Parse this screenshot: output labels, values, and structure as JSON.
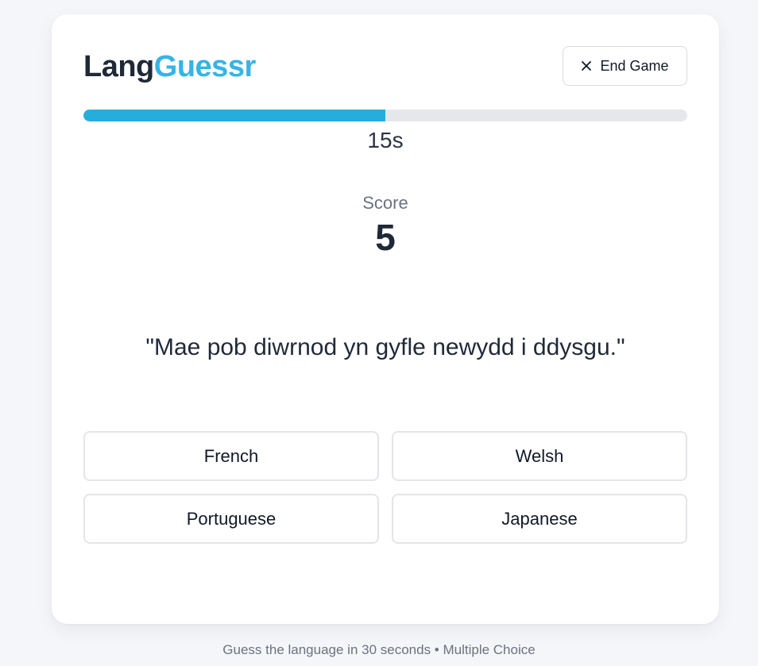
{
  "header": {
    "logo_part1": "Lang",
    "logo_part2": "Guessr",
    "end_button_label": "End Game",
    "end_button_icon": "close-icon"
  },
  "timer": {
    "label": "15s",
    "progress_fraction": 0.5
  },
  "score": {
    "label": "Score",
    "value": "5"
  },
  "question": {
    "text": "\"Mae pob diwrnod yn gyfle newydd i ddysgu.\""
  },
  "options": [
    "French",
    "Welsh",
    "Portuguese",
    "Japanese"
  ],
  "footer": {
    "text": "Guess the language in 30 seconds • Multiple Choice"
  },
  "colors": {
    "accent": "#36b4e5",
    "progress_fill": "#25aedc",
    "progress_track": "#e6e7eb",
    "background": "#f5f6f9"
  }
}
